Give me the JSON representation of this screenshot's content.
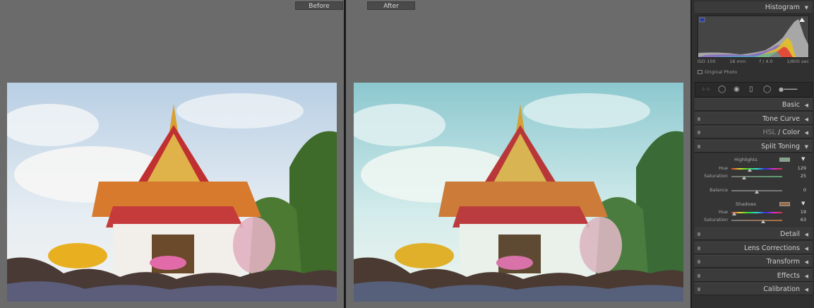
{
  "compare": {
    "before_label": "Before",
    "after_label": "After"
  },
  "histogram": {
    "title": "Histogram",
    "iso": "ISO 100",
    "focal": "18 mm",
    "aperture": "f / 4.0",
    "shutter": "1/800 sec",
    "original_photo": "Original Photo"
  },
  "panels": {
    "basic": "Basic",
    "tone_curve": "Tone Curve",
    "hsl": "HSL",
    "color": "Color",
    "split_toning": "Split Toning",
    "detail": "Detail",
    "lens_corrections": "Lens Corrections",
    "transform": "Transform",
    "effects": "Effects",
    "calibration": "Calibration"
  },
  "split_toning": {
    "highlights": {
      "title": "Highlights",
      "swatch_color": "#7fa58a",
      "hue_label": "Hue",
      "hue_value": "129",
      "hue": 129,
      "saturation_label": "Saturation",
      "saturation_value": "25",
      "saturation": 25
    },
    "balance_label": "Balance",
    "balance_value": "0",
    "balance": 0,
    "shadows": {
      "title": "Shadows",
      "swatch_color": "#9a6a44",
      "hue_label": "Hue",
      "hue_value": "19",
      "hue": 19,
      "saturation_label": "Saturation",
      "saturation_value": "63",
      "saturation": 63
    }
  }
}
